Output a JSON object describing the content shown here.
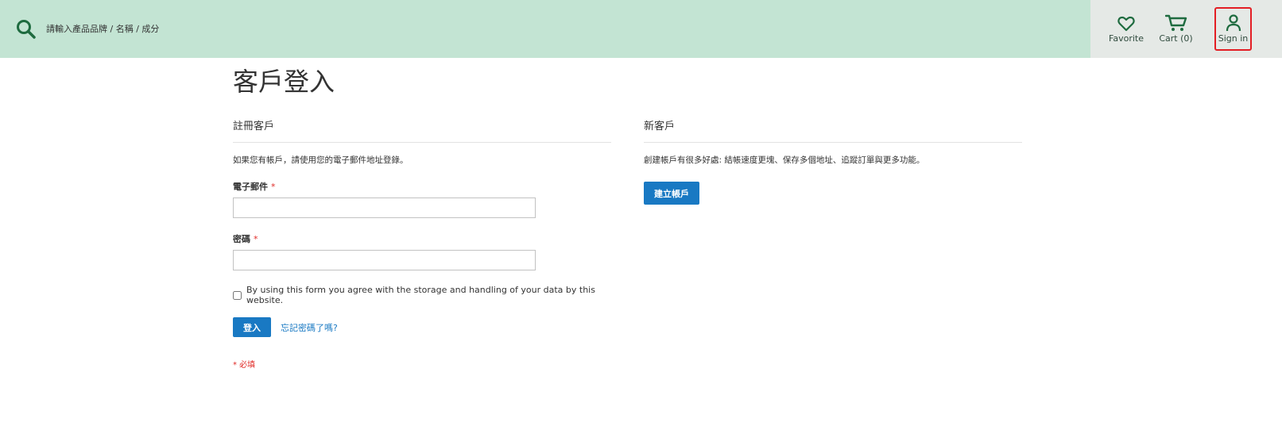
{
  "header": {
    "search": {
      "placeholder": "請輸入產品品牌 / 名稱 / 成分"
    },
    "actions": {
      "favorite_label": "Favorite",
      "cart_label": "Cart (0)",
      "signin_label": "Sign in"
    }
  },
  "main": {
    "page_title": "客戶登入",
    "registered": {
      "title": "註冊客戶",
      "description": "如果您有帳戶，請使用您的電子郵件地址登錄。",
      "email_label": "電子郵件",
      "password_label": "密碼",
      "required_mark": "*",
      "consent_text": "By using this form you agree with the storage and handling of your data by this website.",
      "login_button": "登入",
      "forgot_link": "忘記密碼了嗎?",
      "required_note": "* 必填"
    },
    "new_customer": {
      "title": "新客戶",
      "description": "創建帳戶有很多好處: 結帳速度更塊、保存多個地址、追蹤訂單與更多功能。",
      "create_button": "建立帳戶"
    }
  },
  "colors": {
    "header_green": "#c3e4d3",
    "header_actions_bg": "#e5e9e6",
    "brand_dark_green": "#1e6b3f",
    "primary_blue": "#1979c3",
    "required_red": "#e02b27",
    "highlight_red": "#e31e24"
  },
  "icons": [
    "search-icon",
    "heart-icon",
    "cart-icon",
    "user-icon"
  ]
}
